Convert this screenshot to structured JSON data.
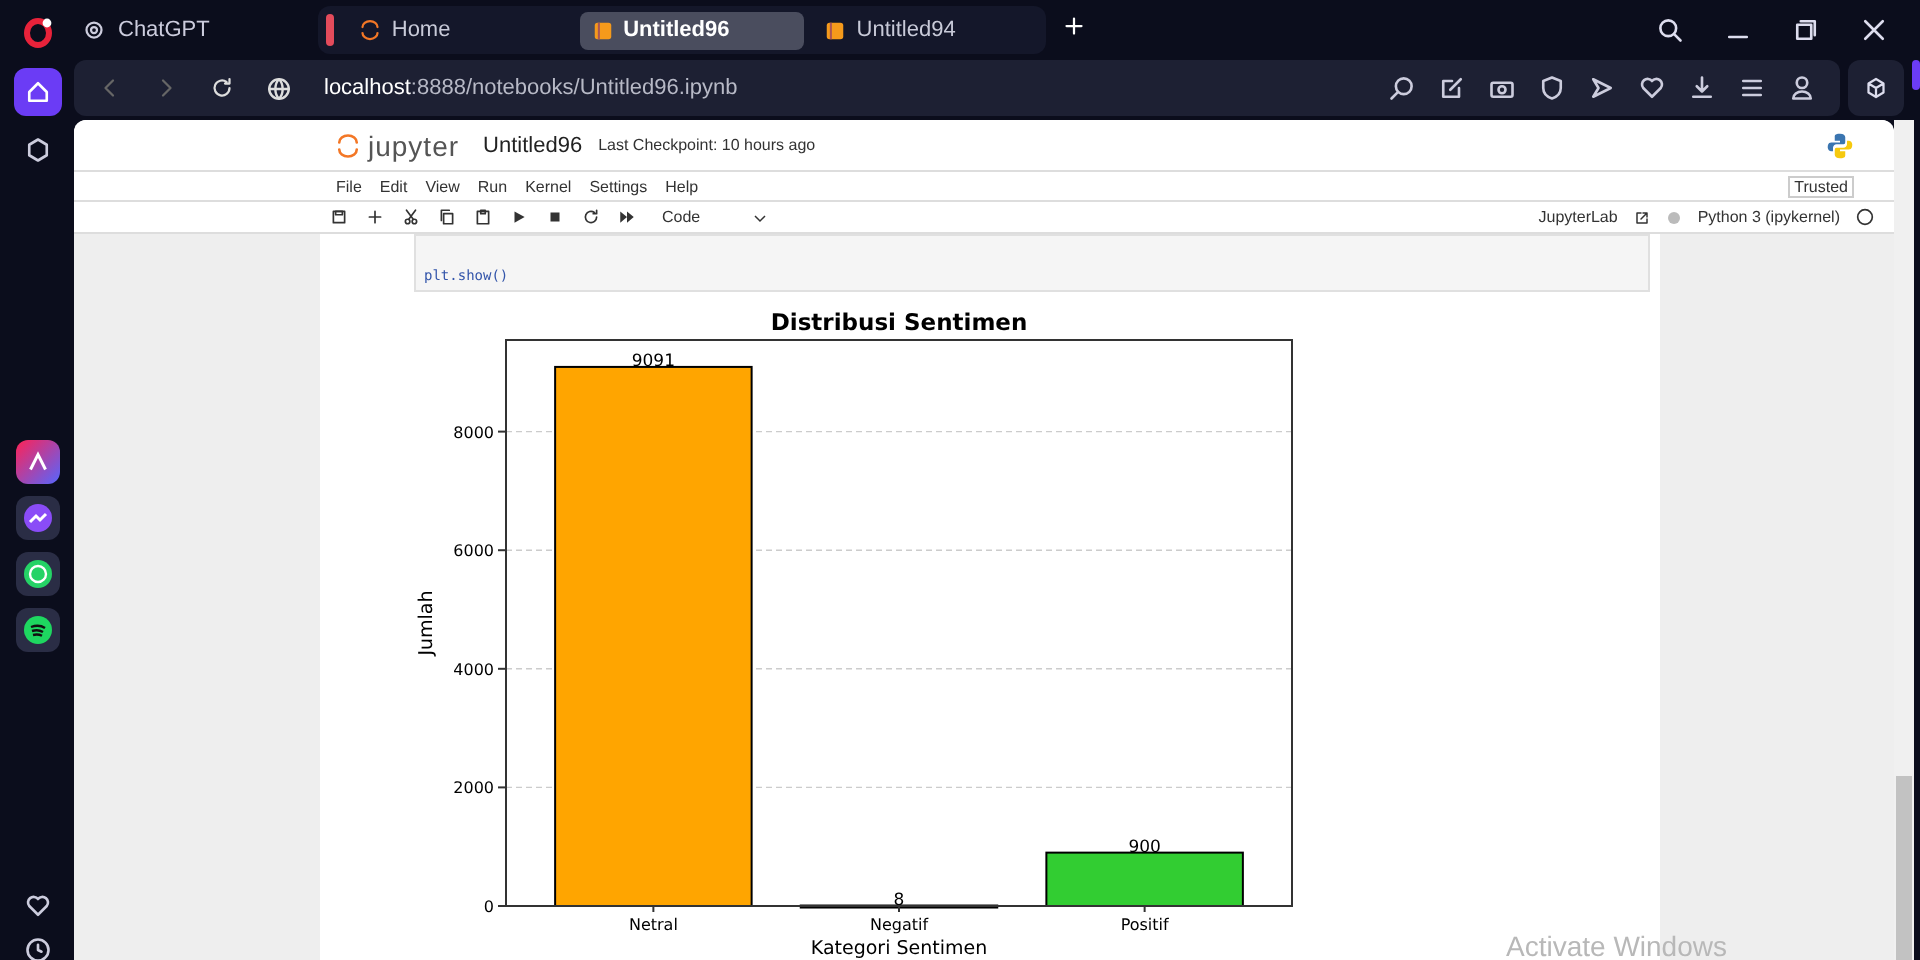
{
  "browser": {
    "tabs": [
      {
        "label": "ChatGPT",
        "selected": false
      },
      {
        "label": "Home",
        "selected": false
      },
      {
        "label": "Untitled96",
        "selected": true
      },
      {
        "label": "Untitled94",
        "selected": false
      }
    ],
    "address": {
      "host": "localhost",
      "path": ":8888/notebooks/Untitled96.ipynb"
    }
  },
  "jupyter": {
    "logo_text": "jupyter",
    "notebook_name": "Untitled96",
    "checkpoint": "Last Checkpoint: 10 hours ago",
    "menu": [
      "File",
      "Edit",
      "View",
      "Run",
      "Kernel",
      "Settings",
      "Help"
    ],
    "trusted": "Trusted",
    "cell_type": "Code",
    "jupyterlab_link": "JupyterLab",
    "kernel": "Python 3 (ipykernel)",
    "code_line": "plt.show()",
    "chart_data": {
      "type": "bar",
      "title": "Distribusi Sentimen",
      "xlabel": "Kategori Sentimen",
      "ylabel": "Jumlah",
      "categories": [
        "Netral",
        "Negatif",
        "Positif"
      ],
      "series": [
        {
          "color": "#ffa500",
          "values": [
            9091,
            null,
            null
          ]
        },
        {
          "color": "#ff0000",
          "values": [
            null,
            8,
            null
          ]
        },
        {
          "color": "#32cd32",
          "values": [
            null,
            null,
            900
          ]
        }
      ],
      "stacked": true,
      "grid": true,
      "ylim": [
        0,
        9545
      ],
      "yticks": [
        0,
        2000,
        4000,
        6000,
        8000
      ],
      "data_labels": true
    }
  },
  "overlay": {
    "text": "Activate Windows"
  }
}
